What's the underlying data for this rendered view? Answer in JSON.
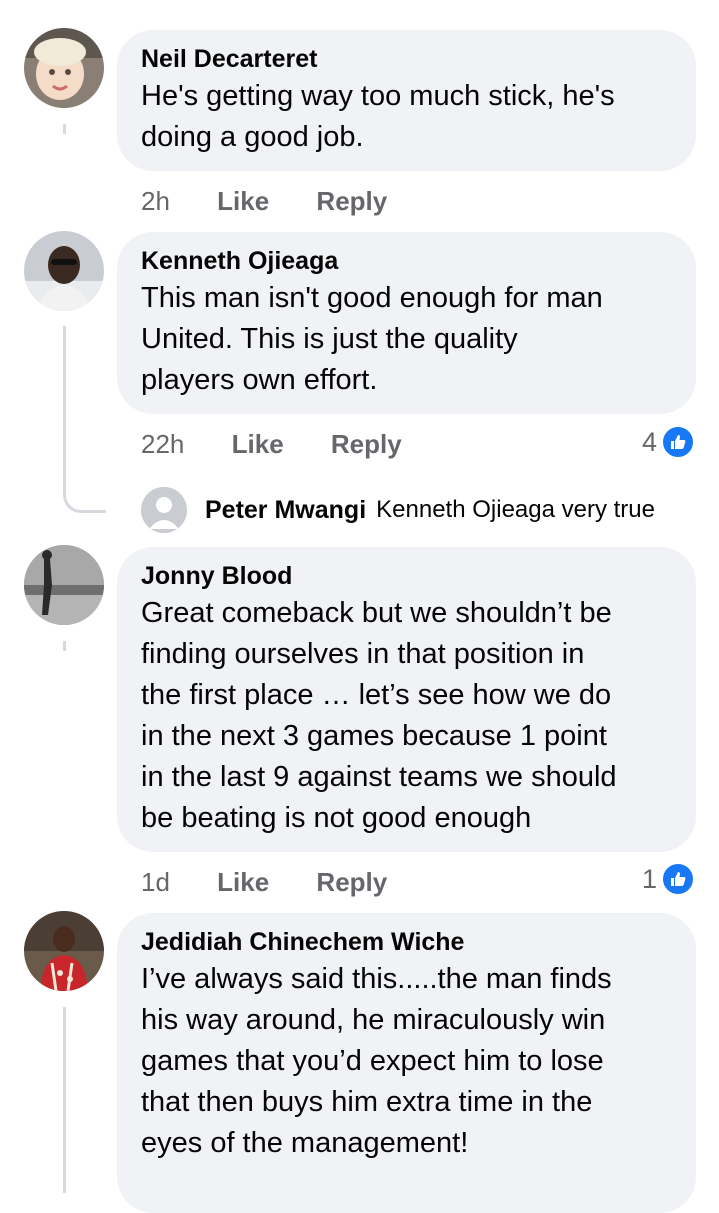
{
  "comments": [
    {
      "name": "Neil Decarteret",
      "text_lines": [
        "He's getting way too much stick, he's",
        "doing a good job."
      ],
      "time": "2h",
      "like_label": "Like",
      "reply_label": "Reply"
    },
    {
      "name": "Kenneth Ojieaga",
      "text_lines": [
        "This man isn't good enough for man",
        "United.  This is just the quality",
        "players own effort."
      ],
      "time": "22h",
      "like_label": "Like",
      "reply_label": "Reply",
      "reaction_count": "4"
    },
    {
      "name": "Jonny Blood",
      "text_lines": [
        "Great comeback but we shouldn’t be",
        "finding ourselves in that position in",
        "the first place … let’s see how we do",
        "in the next 3 games because 1 point",
        "in the last 9 against teams we should",
        "be beating is not good enough"
      ],
      "time": "1d",
      "like_label": "Like",
      "reply_label": "Reply",
      "reaction_count": "1"
    },
    {
      "name": "Jedidiah Chinechem Wiche",
      "text_lines": [
        "I’ve always said this.....the man finds",
        "his way around, he miraculously win",
        "games that you’d expect him to lose",
        "that then buys him extra time in the",
        "eyes  of the management!"
      ]
    }
  ],
  "reply_preview": {
    "name": "Peter Mwangi",
    "text": "Kenneth Ojieaga very true"
  },
  "icons": {
    "reaction": "like-thumb-icon",
    "default_avatar": "default-avatar-icon"
  },
  "colors": {
    "bubble": "#f0f2f5",
    "meta_text": "#65676b",
    "like_blue": "#1877f2",
    "thread_line": "#d6d9dd"
  }
}
